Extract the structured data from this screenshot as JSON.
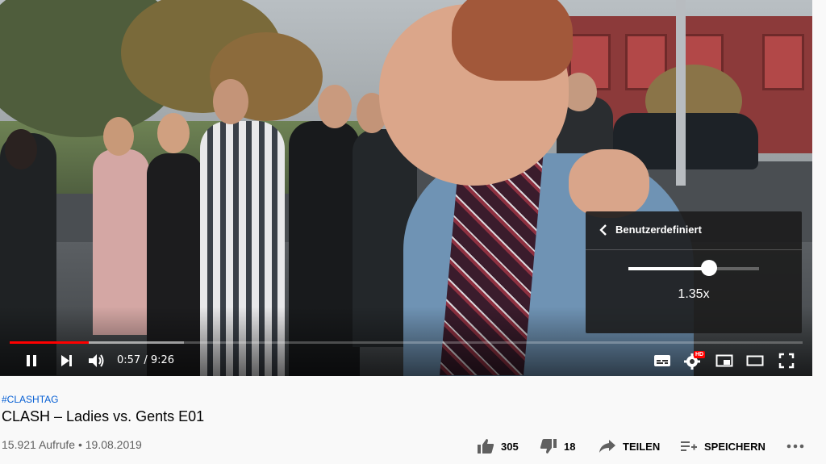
{
  "player": {
    "time_current": "0:57",
    "time_separator": " / ",
    "time_total": "9:26",
    "progress_played": 0.1,
    "progress_loaded": 0.22,
    "hd_badge": "HD",
    "icons": {
      "pause": "pause-icon",
      "next": "next-icon",
      "volume": "volume-icon",
      "subtitles": "subtitles-icon",
      "settings": "settings-gear-icon",
      "miniplayer": "miniplayer-icon",
      "theater": "theater-mode-icon",
      "fullscreen": "fullscreen-icon"
    }
  },
  "settings_panel": {
    "title": "Benutzerdefiniert",
    "speed_label": "1.35x",
    "speed_level": 0.62
  },
  "video": {
    "hashtag": "#CLASHTAG",
    "title": "CLASH – Ladies vs. Gents E01",
    "meta": "15.921 Aufrufe • 19.08.2019"
  },
  "actions": {
    "like_count": "305",
    "dislike_count": "18",
    "share_label": "TEILEN",
    "save_label": "SPEICHERN"
  },
  "colors": {
    "progress_red": "#ff0000",
    "link_blue": "#065fd4",
    "meta_gray": "#606060"
  }
}
